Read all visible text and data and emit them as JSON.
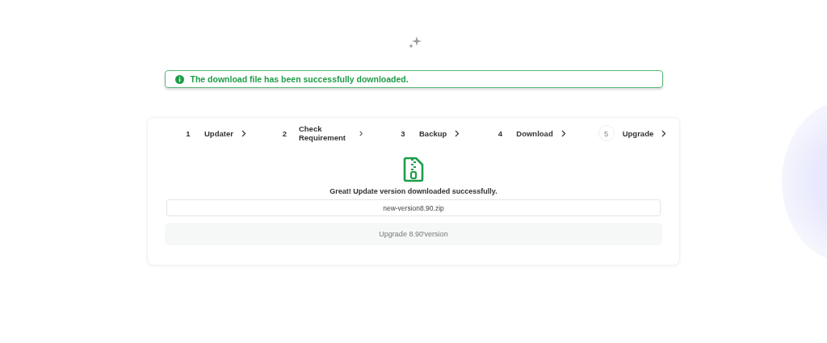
{
  "alert": {
    "text": "The download file has been successfully downloaded."
  },
  "steps": [
    {
      "number": "1",
      "label": "Updater",
      "selected": false
    },
    {
      "number": "2",
      "label": "Check Requirement",
      "selected": false
    },
    {
      "number": "3",
      "label": "Backup",
      "selected": false
    },
    {
      "number": "4",
      "label": "Download",
      "selected": false
    },
    {
      "number": "5",
      "label": "Upgrade",
      "selected": true
    }
  ],
  "message": "Great! Update version downloaded successfully.",
  "file_field": {
    "value": "new-version8.90.zip"
  },
  "upgrade_button": {
    "label": "Upgrade 8.90'version"
  }
}
